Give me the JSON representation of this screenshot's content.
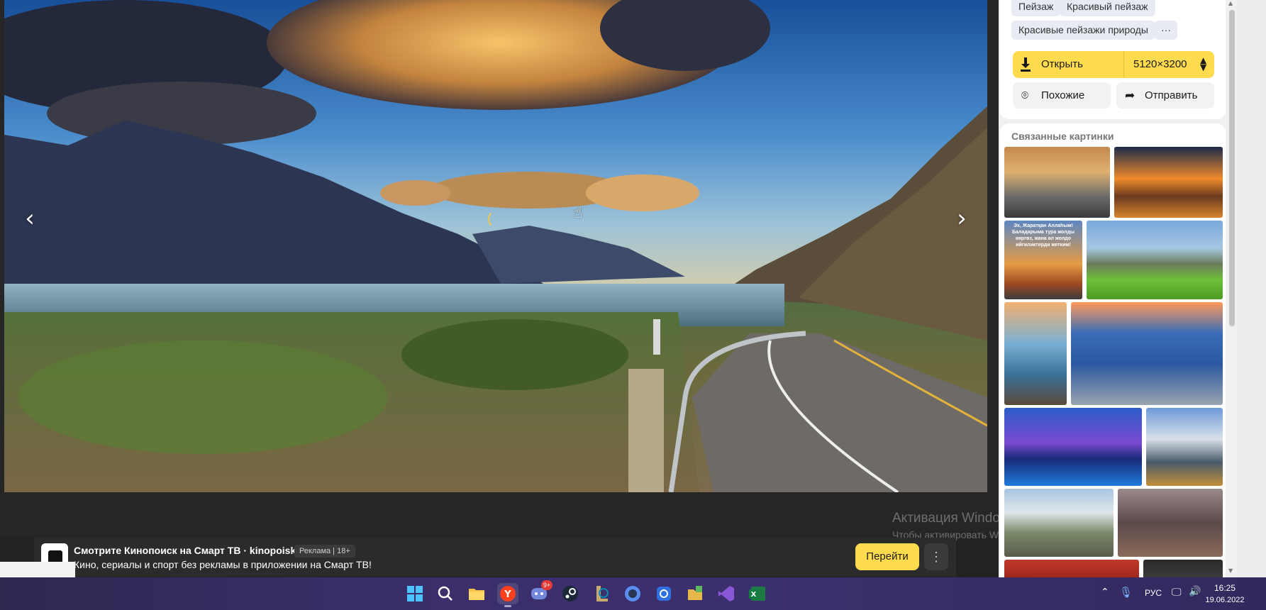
{
  "viewer": {
    "prev_arrow": "‹",
    "next_arrow": "›"
  },
  "ad": {
    "title": "Смотрите Кинопоиск на Смарт ТВ · kinopoisk.ru",
    "badge": "Реклама | 18+",
    "description": "Кино, сериалы и спорт без рекламы в приложении на Смарт ТВ!",
    "go_label": "Перейти",
    "menu_label": "⋮"
  },
  "watermark": {
    "title": "Активация Windows",
    "subtitle": "Чтобы активировать Windows, перейдите в раздел \"Параметры\"."
  },
  "sidebar": {
    "tags": [
      "Пейзаж",
      "Красивый пейзаж",
      "Красивые пейзажи природы"
    ],
    "more_tags_label": "···",
    "open_label": "Открыть",
    "size_value": "5120×3200",
    "similar_label": "Похожие",
    "share_label": "Отправить",
    "related_title": "Связанные картинки",
    "thumb_text": "Эх, Жаратқан Аллаһым! Баладарыма тура жолды көргөз, жана ал жолдо ийгиликтерди жетким!"
  },
  "taskbar": {
    "apps": [
      "start-icon",
      "search-icon",
      "file-explorer-icon",
      "yandex-browser-icon",
      "discord-icon",
      "steam-icon",
      "league-icon",
      "obs-icon",
      "app-icon",
      "files-icon",
      "visual-studio-icon",
      "excel-icon"
    ],
    "discord_badge": "9+",
    "language": "РУС",
    "time": "16:25",
    "date": "19.06.2022"
  },
  "colors": {
    "accent_yellow": "#ffdb4d",
    "tag_bg": "#e8ebf4",
    "taskbar": "#3b2e6b"
  }
}
